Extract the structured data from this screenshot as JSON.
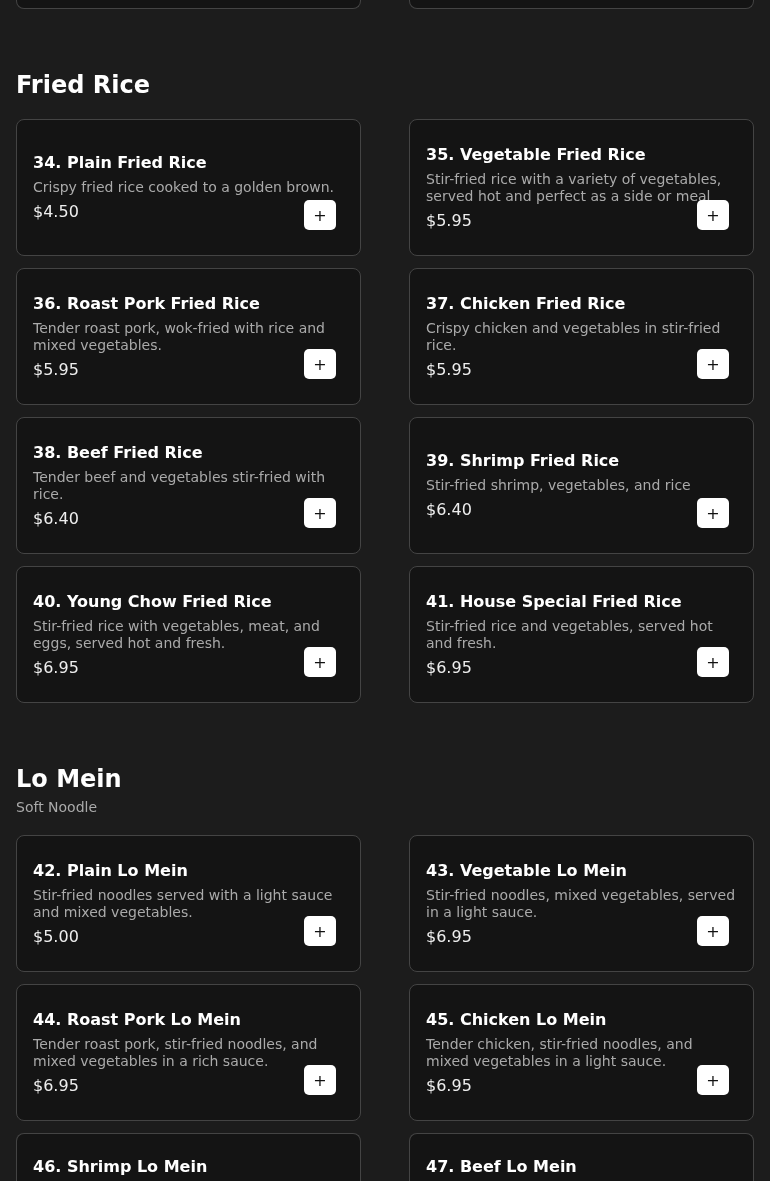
{
  "sections": [
    {
      "title": "Fried Rice",
      "items": [
        {
          "name": "34. Plain Fried Rice",
          "description": "Crispy fried rice cooked to a golden brown.",
          "price": "$4.50",
          "button": "+"
        },
        {
          "name": "35. Vegetable Fried Rice",
          "description": "Stir-fried rice with a variety of vegetables, served hot and perfect as a side or meal",
          "price": "$5.95",
          "button": "+"
        },
        {
          "name": "36. Roast Pork Fried Rice",
          "description": "Tender roast pork, wok-fried with rice and mixed vegetables.",
          "price": "$5.95",
          "button": "+"
        },
        {
          "name": "37. Chicken Fried Rice",
          "description": "Crispy chicken and vegetables in stir-fried rice.",
          "price": "$5.95",
          "button": "+"
        },
        {
          "name": "38. Beef Fried Rice",
          "description": "Tender beef and vegetables stir-fried with rice.",
          "price": "$6.40",
          "button": "+"
        },
        {
          "name": "39. Shrimp Fried Rice",
          "description": "Stir-fried shrimp, vegetables, and rice",
          "price": "$6.40",
          "button": "+"
        },
        {
          "name": "40. Young Chow Fried Rice",
          "description": "Stir-fried rice with vegetables, meat, and eggs, served hot and fresh.",
          "price": "$6.95",
          "button": "+"
        },
        {
          "name": "41. House Special Fried Rice",
          "description": "Stir-fried rice and vegetables, served hot and fresh.",
          "price": "$6.95",
          "button": "+"
        }
      ]
    },
    {
      "title": "Lo Mein",
      "subtitle": "Soft Noodle",
      "items": [
        {
          "name": "42. Plain Lo Mein",
          "description": "Stir-fried noodles served with a light sauce and mixed vegetables.",
          "price": "$5.00",
          "button": "+"
        },
        {
          "name": "43. Vegetable Lo Mein",
          "description": "Stir-fried noodles, mixed vegetables, served in a light sauce.",
          "price": "$6.95",
          "button": "+"
        },
        {
          "name": "44. Roast Pork Lo Mein",
          "description": "Tender roast pork, stir-fried noodles, and mixed vegetables in a rich sauce.",
          "price": "$6.95",
          "button": "+"
        },
        {
          "name": "45. Chicken Lo Mein",
          "description": "Tender chicken, stir-fried noodles, and mixed vegetables in a light sauce.",
          "price": "$6.95",
          "button": "+"
        },
        {
          "name": "46. Shrimp Lo Mein"
        },
        {
          "name": "47. Beef Lo Mein"
        }
      ]
    }
  ]
}
